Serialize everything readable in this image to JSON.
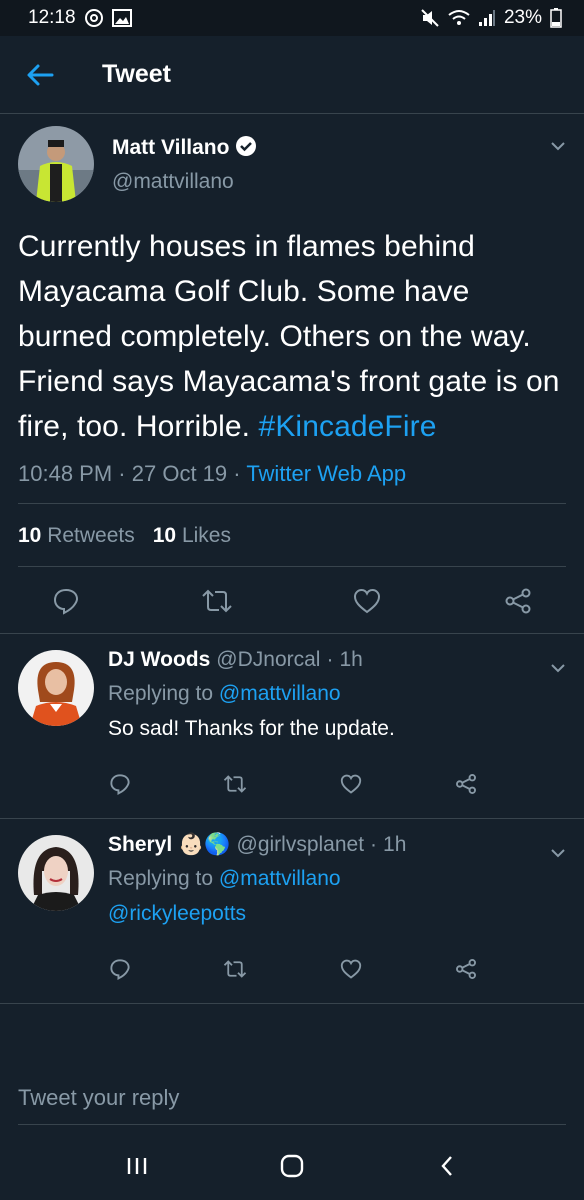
{
  "status_bar": {
    "time": "12:18",
    "battery": "23%"
  },
  "app_bar": {
    "title": "Tweet"
  },
  "main_tweet": {
    "name": "Matt Villano",
    "handle": "@mattvillano",
    "text": "Currently houses in flames behind Mayacama Golf Club. Some have burned completely. Others on the way. Friend says Mayacama's front gate is on fire, too. Horrible.",
    "hashtag": "#KincadeFire",
    "time": "10:48 PM",
    "date": "27 Oct 19",
    "separator": "·",
    "source": "Twitter Web App",
    "retweets_count": "10",
    "retweets_label": "Retweets",
    "likes_count": "10",
    "likes_label": "Likes"
  },
  "replies": [
    {
      "name": "DJ Woods",
      "handle": "@DJnorcal",
      "time": "1h",
      "replying_prefix": "Replying to",
      "replying_to": "@mattvillano",
      "text": "So sad! Thanks for the update."
    },
    {
      "name": "Sheryl",
      "emoji": "👶🏻🌎",
      "handle": "@girlvsplanet",
      "time": "1h",
      "replying_prefix": "Replying to",
      "replying_to": "@mattvillano",
      "mention": "@rickyleepotts"
    }
  ],
  "compose": {
    "placeholder": "Tweet your reply"
  },
  "colors": {
    "background": "#15202b",
    "accent": "#1da1f2",
    "muted": "#8899a6",
    "divider": "#38444d"
  }
}
